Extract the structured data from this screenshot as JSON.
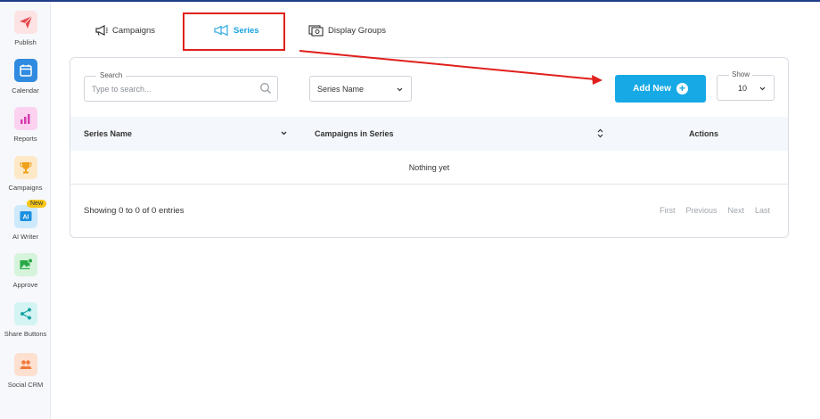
{
  "sidebar": {
    "items": [
      {
        "label": "Publish",
        "icon": "paper-plane-icon",
        "bg": "#fde3e3",
        "color": "#e5484d"
      },
      {
        "label": "Calendar",
        "icon": "calendar-icon",
        "bg": "#2f8ae0",
        "color": "#ffffff"
      },
      {
        "label": "Reports",
        "icon": "bar-chart-icon",
        "bg": "#fbd3f0",
        "color": "#d63cb0"
      },
      {
        "label": "Campaigns",
        "icon": "trophy-icon",
        "bg": "#fde9c8",
        "color": "#f0a01a"
      },
      {
        "label": "AI Writer",
        "icon": "ai-icon",
        "bg": "#cde9fb",
        "color": "#1a8fe0",
        "badge": "New"
      },
      {
        "label": "Approve",
        "icon": "image-check-icon",
        "bg": "#d6f3dc",
        "color": "#27a845"
      },
      {
        "label": "Share Buttons",
        "icon": "share-icon",
        "bg": "#d4f3f3",
        "color": "#17a3a3"
      },
      {
        "label": "Social CRM",
        "icon": "people-icon",
        "bg": "#fde0d0",
        "color": "#f07a3a"
      }
    ]
  },
  "tabs": {
    "campaigns": "Campaigns",
    "series": "Series",
    "display_groups": "Display Groups"
  },
  "toolbar": {
    "search_label": "Search",
    "search_placeholder": "Type to search...",
    "search_value": "",
    "sort_select": "Series Name",
    "add_new": "Add New",
    "show_label": "Show",
    "show_value": "10"
  },
  "table": {
    "columns": [
      "Series Name",
      "Campaigns in Series",
      "Actions"
    ],
    "empty_text": "Nothing yet"
  },
  "footer": {
    "entries": "Showing 0 to 0 of 0 entries",
    "pager": [
      "First",
      "Previous",
      "Next",
      "Last"
    ]
  },
  "colors": {
    "accent": "#17a9e5",
    "annotation": "#e0201c"
  }
}
